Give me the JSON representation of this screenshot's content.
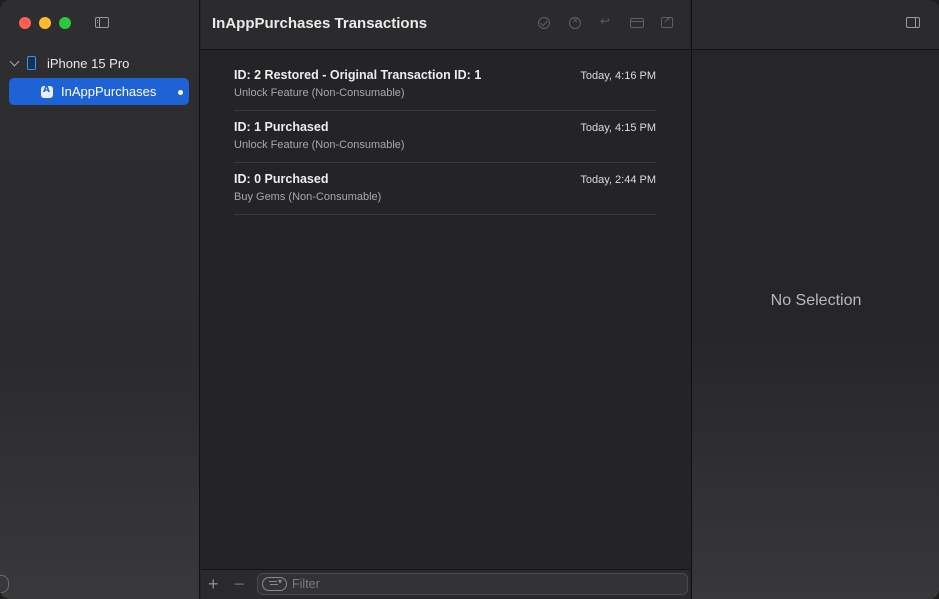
{
  "window": {
    "title": "InAppPurchases Transactions"
  },
  "sidebar": {
    "device": "iPhone 15 Pro",
    "items": [
      {
        "label": "InAppPurchases",
        "selected": true
      }
    ]
  },
  "transactions": [
    {
      "title": "ID: 2 Restored - Original Transaction ID: 1",
      "subtitle": "Unlock Feature (Non-Consumable)",
      "time": "Today, 4:16 PM"
    },
    {
      "title": "ID: 1 Purchased",
      "subtitle": "Unlock Feature (Non-Consumable)",
      "time": "Today, 4:15 PM"
    },
    {
      "title": "ID: 0 Purchased",
      "subtitle": "Buy Gems (Non-Consumable)",
      "time": "Today, 2:44 PM"
    }
  ],
  "bottom_bar": {
    "add_label": "+",
    "remove_label": "−",
    "filter_placeholder": "Filter"
  },
  "detail": {
    "empty_text": "No Selection"
  },
  "colors": {
    "accent": "#1e63d6",
    "close": "#ff5f57",
    "minimize": "#febc2e",
    "zoom": "#28c840"
  }
}
